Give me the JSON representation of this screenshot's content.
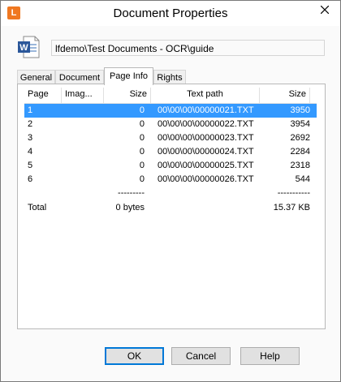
{
  "window": {
    "title": "Document Properties",
    "app_icon_letter": "L"
  },
  "document": {
    "path": "lfdemo\\Test Documents - OCR\\guide"
  },
  "tabs": [
    {
      "label": "General"
    },
    {
      "label": "Document"
    },
    {
      "label": "Page Info"
    },
    {
      "label": "Rights"
    }
  ],
  "table": {
    "headers": {
      "page": "Page",
      "image": "Imag...",
      "size": "Size",
      "path": "Text path",
      "size2": "Size"
    },
    "rows": [
      {
        "page": "1",
        "size": "0",
        "path": "00\\00\\00\\00000021.TXT",
        "size2": "3950",
        "selected": true
      },
      {
        "page": "2",
        "size": "0",
        "path": "00\\00\\00\\00000022.TXT",
        "size2": "3954"
      },
      {
        "page": "3",
        "size": "0",
        "path": "00\\00\\00\\00000023.TXT",
        "size2": "2692"
      },
      {
        "page": "4",
        "size": "0",
        "path": "00\\00\\00\\00000024.TXT",
        "size2": "2284"
      },
      {
        "page": "5",
        "size": "0",
        "path": "00\\00\\00\\00000025.TXT",
        "size2": "2318"
      },
      {
        "page": "6",
        "size": "0",
        "path": "00\\00\\00\\00000026.TXT",
        "size2": "544"
      }
    ],
    "separator_left": "---------",
    "separator_right": "-----------",
    "total": {
      "label": "Total",
      "size": "0 bytes",
      "size2": "15.37 KB"
    }
  },
  "buttons": {
    "ok": "OK",
    "cancel": "Cancel",
    "help": "Help"
  },
  "colors": {
    "selection": "#3399ff",
    "app_icon": "#f07821"
  }
}
